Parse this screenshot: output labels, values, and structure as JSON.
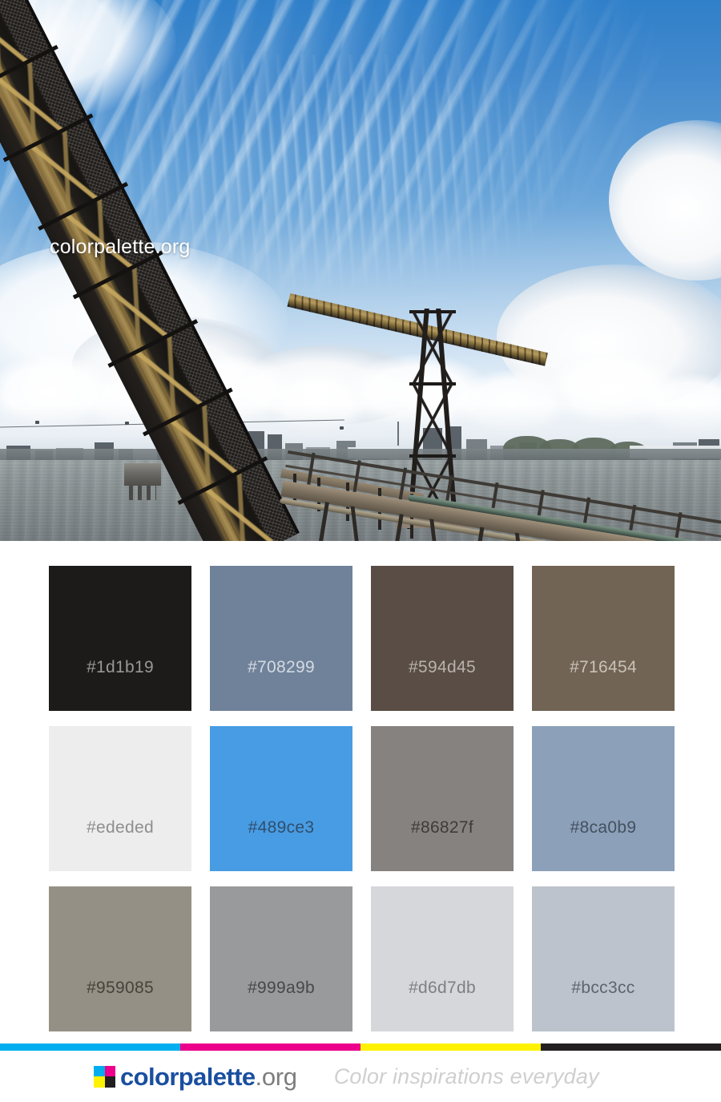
{
  "photo": {
    "watermark": "colorpalette.org",
    "alt_subject": "steel conveyor bridge over river with city skyline",
    "sky_top_color": "#2f7fc9",
    "water_color": "#868e90"
  },
  "palette": {
    "swatches": [
      {
        "hex": "#1d1b19",
        "label": "#1d1b19",
        "text_color": "#9a9894"
      },
      {
        "hex": "#708299",
        "label": "#708299",
        "text_color": "#d3dae3"
      },
      {
        "hex": "#594d45",
        "label": "#594d45",
        "text_color": "#b9b2ac"
      },
      {
        "hex": "#716454",
        "label": "#716454",
        "text_color": "#cac2b7"
      },
      {
        "hex": "#ededed",
        "label": "#ededed",
        "text_color": "#8e8e8e"
      },
      {
        "hex": "#489ce3",
        "label": "#489ce3",
        "text_color": "#2f4f6e"
      },
      {
        "hex": "#86827f",
        "label": "#86827f",
        "text_color": "#3e3b39"
      },
      {
        "hex": "#8ca0b9",
        "label": "#8ca0b9",
        "text_color": "#43505f"
      },
      {
        "hex": "#959085",
        "label": "#959085",
        "text_color": "#45423c"
      },
      {
        "hex": "#999a9b",
        "label": "#999a9b",
        "text_color": "#474849"
      },
      {
        "hex": "#d6d7db",
        "label": "#d6d7db",
        "text_color": "#7e7f83"
      },
      {
        "hex": "#bcc3cc",
        "label": "#bcc3cc",
        "text_color": "#5f646b"
      }
    ]
  },
  "footer": {
    "cmyk_bar": [
      "#00aeef",
      "#ec008c",
      "#fff200",
      "#231f20"
    ],
    "logo_tiles": [
      "#00aeef",
      "#ec008c",
      "#fff200",
      "#231f20"
    ],
    "brand_name": "colorpalette",
    "brand_tld": ".org",
    "tagline": "Color inspirations everyday",
    "brand_color": "#1a4fa0",
    "tld_color": "#7d7d7d"
  }
}
